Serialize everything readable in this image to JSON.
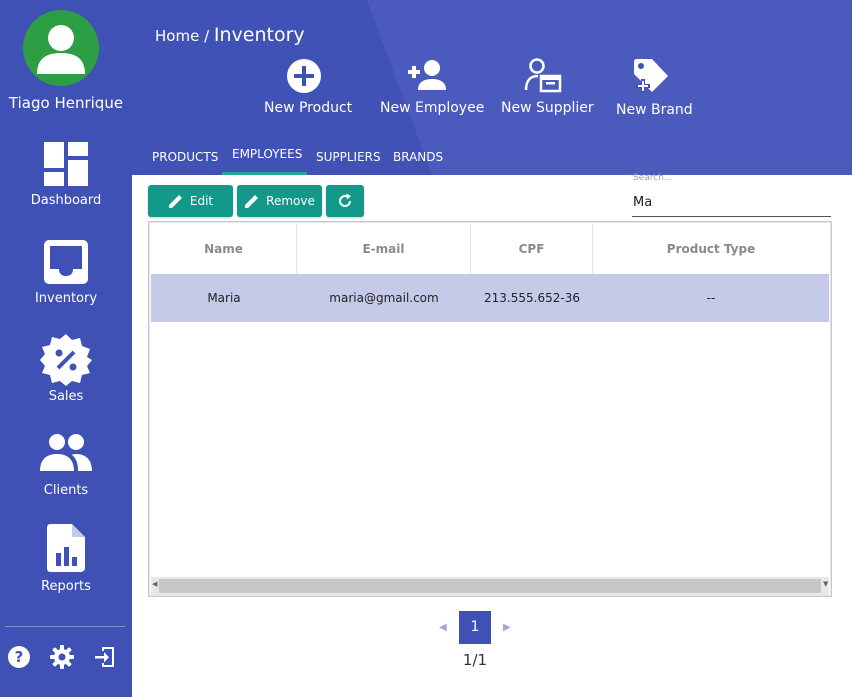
{
  "user": {
    "name": "Tiago Henrique"
  },
  "nav": [
    {
      "label": "Dashboard",
      "icon": "dashboard-icon"
    },
    {
      "label": "Inventory",
      "icon": "inbox-icon"
    },
    {
      "label": "Sales",
      "icon": "discount-badge-icon"
    },
    {
      "label": "Clients",
      "icon": "people-icon"
    },
    {
      "label": "Reports",
      "icon": "report-icon"
    }
  ],
  "bottom_icons": [
    "help-icon",
    "gear-icon",
    "logout-icon"
  ],
  "breadcrumb": {
    "root": "Home /",
    "current": "Inventory"
  },
  "actions": [
    {
      "label": "New Product",
      "icon": "plus-circle-icon"
    },
    {
      "label": "New Employee",
      "icon": "add-user-icon"
    },
    {
      "label": "New Supplier",
      "icon": "supplier-icon"
    },
    {
      "label": "New Brand",
      "icon": "add-tag-icon"
    }
  ],
  "tabs": [
    {
      "label": "PRODUCTS",
      "active": false
    },
    {
      "label": "EMPLOYEES",
      "active": true
    },
    {
      "label": "SUPPLIERS",
      "active": false
    },
    {
      "label": "BRANDS",
      "active": false
    }
  ],
  "toolbar": {
    "edit_label": "Edit",
    "remove_label": "Remove"
  },
  "search": {
    "label": "Search...",
    "value": "Ma"
  },
  "table": {
    "columns": [
      "Name",
      "E-mail",
      "CPF",
      "Product Type"
    ],
    "rows": [
      [
        "Maria",
        "maria@gmail.com",
        "213.555.652-36",
        "--"
      ]
    ]
  },
  "pagination": {
    "current": "1",
    "info": "1/1"
  },
  "colors": {
    "primary": "#3f51b5",
    "accent": "#13998a",
    "selected_row": "#c5cae9",
    "avatar": "#2e9e45"
  }
}
